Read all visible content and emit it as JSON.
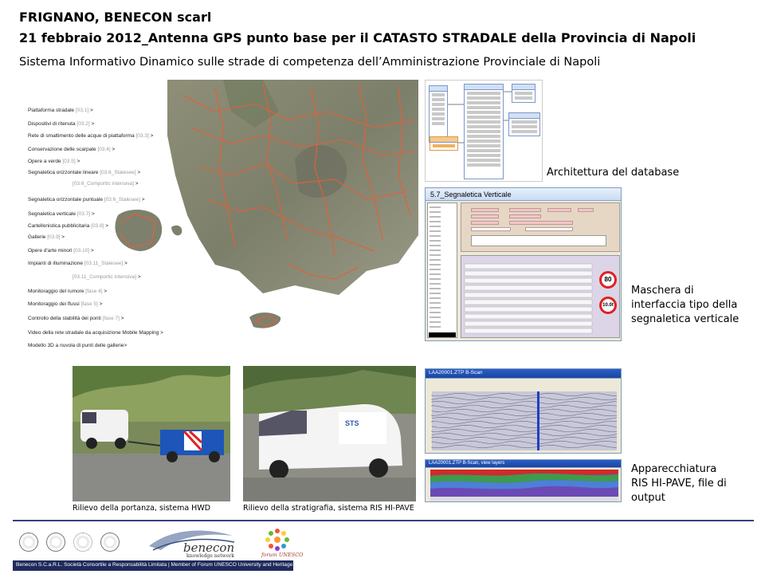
{
  "header": {
    "title_line1": "FRIGNANO, BENECON scarl",
    "title_line2": "21 febbraio  2012_Antenna GPS punto base per il CATASTO STRADALE della Provincia  di Napoli",
    "subtitle": "Sistema Informativo Dinamico sulle strade di competenza dell’Amministrazione Provinciale di Napoli"
  },
  "map": {
    "layers": [
      {
        "label": "Piattaforma stradale",
        "code": "[03.1]",
        "suffix": " >"
      },
      {
        "label": "Dispositivi di ritenuta",
        "code": "[03.2]",
        "suffix": " >"
      },
      {
        "label": "Rete di smaltimento delle acque di piattaforma",
        "code": "[03.3]",
        "suffix": " >"
      },
      {
        "label": "Conservazione delle scarpate",
        "code": "[03.4]",
        "suffix": " >"
      },
      {
        "label": "Opere a verde",
        "code": "[03.5]",
        "suffix": " >"
      },
      {
        "label": "Segnaletica orizzontale lineare",
        "code": "[03.6_Stalesee]",
        "suffix": " >"
      },
      {
        "label": "",
        "code": "[03.6_Comportic intensiva]",
        "suffix": " >"
      },
      {
        "label": "Segnaletica orizzontale puntuale",
        "code": "[03.6_Stalesee]",
        "suffix": " >"
      },
      {
        "label": "Segnaletica verticale",
        "code": "[03.7]",
        "suffix": " >"
      },
      {
        "label": "Cartellonistica pubblicitaria",
        "code": "[03.8]",
        "suffix": " >"
      },
      {
        "label": "Gallerie",
        "code": "[03.9]",
        "suffix": " >"
      },
      {
        "label": "Opere d'arte minori",
        "code": "[03.10]",
        "suffix": " >"
      },
      {
        "label": "Impianti di illuminazione",
        "code": "[03.11_Stalesee]",
        "suffix": " >"
      },
      {
        "label": "",
        "code": "[03.11_Comportic intensiva]",
        "suffix": " >"
      },
      {
        "label": "Monitoraggio del rumore",
        "code": "[fase 4]",
        "suffix": " >"
      },
      {
        "label": "Monitoraggio dei flussi",
        "code": "[fase 5]",
        "suffix": " >"
      },
      {
        "label": "Controllo della stabilità dei ponti",
        "code": "[fase 7]",
        "suffix": " >"
      },
      {
        "label": "Video della rete stradale da acquisizione Mobile Mapping",
        "code": "",
        "suffix": " >"
      },
      {
        "label": "Modello 3D a nuvola di punti delle gallerie",
        "code": "",
        "suffix": ">"
      }
    ]
  },
  "right_column": {
    "db_caption": "Architettura  del database",
    "form_title": "5.7_Segnaletica Verticale",
    "form_sign_1": "80",
    "form_sign_2": "10.0t",
    "form_caption": "Maschera di interfaccia tipo della segnaletica verticale",
    "ris_caption": "Apparecchiatura RIS HI-PAVE, file di output",
    "ris_win1_title": "LAA20001.ZTP  B-Scan",
    "ris_win2_title": "LAA20001.ZTP  B-Scan, view layers"
  },
  "photos": {
    "hwd_caption": "Rilievo della portanza, sistema HWD",
    "ris_caption": "Rilievo della stratigrafia, sistema RIS HI-PAVE",
    "van_brand": "STS"
  },
  "footer": {
    "bar_text": "Benecon S.C.a.R.L. Società Consortile a Responsabilità Limitata | Member of Forum UNESCO University and Heritage",
    "logo_name": "benecon",
    "logo_tagline": "knowledge network",
    "forum_name": "forum UNESCO",
    "seal_icons": [
      "university-seal-icon",
      "university-seal-icon",
      "university-seal-icon",
      "university-seal-icon"
    ]
  },
  "colors": {
    "accent": "#1f2a5c",
    "road": "#e0613b",
    "sign_red": "#d22"
  }
}
